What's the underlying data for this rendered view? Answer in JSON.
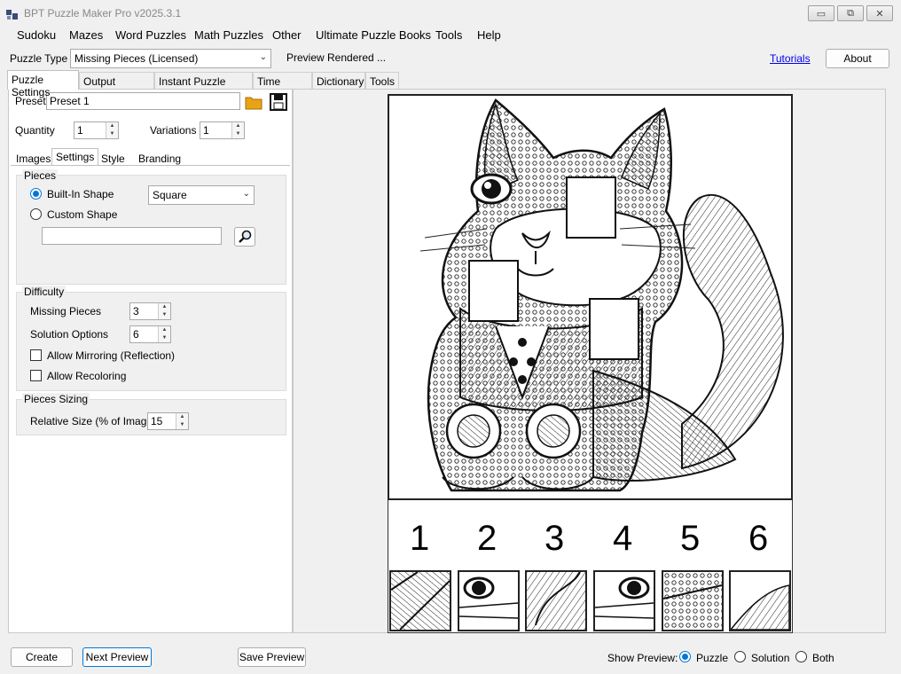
{
  "window": {
    "title": "BPT Puzzle Maker Pro v2025.3.1",
    "minimize_glyph": "▭",
    "maximize_glyph": "⧉",
    "close_glyph": "✕"
  },
  "menu": [
    "Sudoku",
    "Mazes",
    "Word Puzzles",
    "Math Puzzles",
    "Other",
    "Ultimate Puzzle Books",
    "Tools",
    "Help"
  ],
  "toolbar": {
    "puzzle_type_label": "Puzzle Type",
    "puzzle_type_value": "Missing Pieces (Licensed)",
    "status": "Preview Rendered ...",
    "tutorials_link": "Tutorials",
    "about_button": "About"
  },
  "main_tabs": [
    "Puzzle Settings",
    "Output Settings",
    "Instant Puzzle Books",
    "Time Saver",
    "Dictionary",
    "Tools"
  ],
  "left": {
    "preset_label": "Preset",
    "preset_value": "Preset 1",
    "quantity_label": "Quantity",
    "quantity_value": "1",
    "variations_label": "Variations",
    "variations_value": "1",
    "sub_tabs": [
      "Images",
      "Settings",
      "Style",
      "Branding"
    ],
    "pieces_group": {
      "title": "Pieces",
      "builtin_label": "Built-In Shape",
      "builtin_value": "Square",
      "custom_label": "Custom Shape",
      "custom_value": ""
    },
    "difficulty_group": {
      "title": "Difficulty",
      "missing_label": "Missing Pieces",
      "missing_value": "3",
      "solution_label": "Solution Options",
      "solution_value": "6",
      "mirroring_label": "Allow Mirroring (Reflection)",
      "recoloring_label": "Allow Recoloring"
    },
    "sizing_group": {
      "title": "Pieces Sizing",
      "relative_label": "Relative Size (% of Image)",
      "relative_value": "15"
    }
  },
  "preview": {
    "numbers": [
      "1",
      "2",
      "3",
      "4",
      "5",
      "6"
    ]
  },
  "bottom": {
    "create": "Create",
    "next_preview": "Next Preview",
    "save_preview": "Save Preview",
    "show_preview_label": "Show Preview:",
    "opt_puzzle": "Puzzle",
    "opt_solution": "Solution",
    "opt_both": "Both"
  },
  "colors": {
    "accent": "#0078d7",
    "link": "#0000ee",
    "folder_icon": "#e8a317"
  }
}
